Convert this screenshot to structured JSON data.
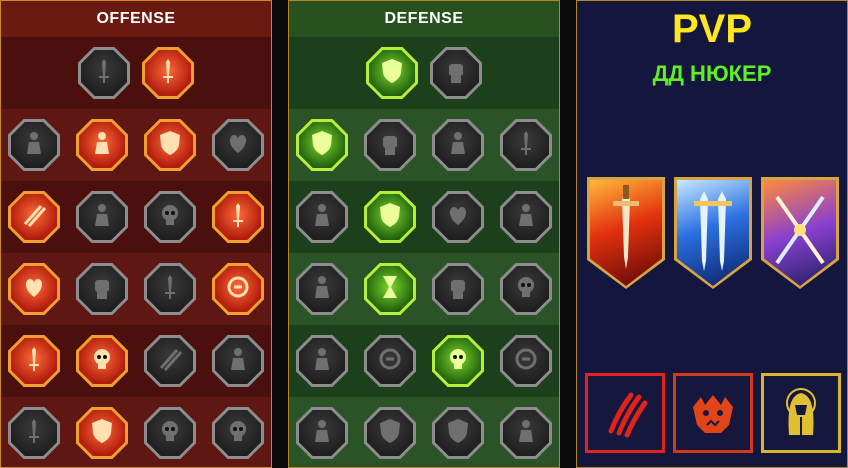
{
  "offense": {
    "title": "OFFENSE",
    "rows": [
      [
        {
          "icon": "crossed-swords-icon",
          "active": false
        },
        {
          "icon": "flaming-sword-icon",
          "active": true
        }
      ],
      [
        {
          "icon": "horned-warrior-icon",
          "active": false
        },
        {
          "icon": "triple-strike-icon",
          "active": true
        },
        {
          "icon": "shield-strike-icon",
          "active": true
        },
        {
          "icon": "heart-crest-icon",
          "active": false
        }
      ],
      [
        {
          "icon": "blade-flurry-icon",
          "active": true
        },
        {
          "icon": "fanged-maw-icon",
          "active": false
        },
        {
          "icon": "skull-bash-icon",
          "active": false
        },
        {
          "icon": "axe-swing-icon",
          "active": true
        }
      ],
      [
        {
          "icon": "bleeding-heart-icon",
          "active": true
        },
        {
          "icon": "iron-fist-icon",
          "active": false
        },
        {
          "icon": "war-axe-icon",
          "active": false
        },
        {
          "icon": "lightning-chain-icon",
          "active": true
        }
      ],
      [
        {
          "icon": "sword-burst-icon",
          "active": true
        },
        {
          "icon": "skull-trio-icon",
          "active": true
        },
        {
          "icon": "arcane-slash-icon",
          "active": false
        },
        {
          "icon": "fury-warrior-icon",
          "active": false
        }
      ],
      [
        {
          "icon": "sparkling-blade-icon",
          "active": false
        },
        {
          "icon": "flaming-helm-icon",
          "active": true
        },
        {
          "icon": "demon-icon",
          "active": false
        },
        {
          "icon": "skull-totem-icon",
          "active": false
        }
      ]
    ]
  },
  "defense": {
    "title": "DEFENSE",
    "rows": [
      [
        {
          "icon": "stacked-shields-icon",
          "active": true
        },
        {
          "icon": "raised-fist-icon",
          "active": false
        }
      ],
      [
        {
          "icon": "chevron-shield-icon",
          "active": true
        },
        {
          "icon": "stone-hand-icon",
          "active": false
        },
        {
          "icon": "armored-torso-icon",
          "active": false
        },
        {
          "icon": "broken-blade-icon",
          "active": false
        }
      ],
      [
        {
          "icon": "leaping-fighter-icon",
          "active": false
        },
        {
          "icon": "knight-shield-icon",
          "active": true
        },
        {
          "icon": "heart-icon",
          "active": false
        },
        {
          "icon": "hooded-head-icon",
          "active": false
        }
      ],
      [
        {
          "icon": "warrior-pair-icon",
          "active": false
        },
        {
          "icon": "hourglass-icon",
          "active": true
        },
        {
          "icon": "open-palm-icon",
          "active": false
        },
        {
          "icon": "bull-skull-icon",
          "active": false
        }
      ],
      [
        {
          "icon": "speed-runner-icon",
          "active": false
        },
        {
          "icon": "water-drops-icon",
          "active": false
        },
        {
          "icon": "radiant-skull-icon",
          "active": true
        },
        {
          "icon": "swirl-arrow-icon",
          "active": false
        }
      ],
      [
        {
          "icon": "stone-golem-icon",
          "active": false
        },
        {
          "icon": "crested-shield-icon",
          "active": false
        },
        {
          "icon": "helmed-face-icon",
          "active": false
        },
        {
          "icon": "strongman-icon",
          "active": false
        }
      ]
    ]
  },
  "pvp": {
    "title": "PVP",
    "subtitle": "ДД НЮКЕР",
    "banners": [
      {
        "icon": "red-sword-banner-icon"
      },
      {
        "icon": "blue-twin-swords-banner-icon"
      },
      {
        "icon": "crossed-swords-banner-icon"
      }
    ],
    "boxes": [
      {
        "icon": "claw-marks-icon"
      },
      {
        "icon": "beast-head-icon"
      },
      {
        "icon": "robed-sage-icon"
      }
    ]
  },
  "colors": {
    "offense_bg": "#5a1410",
    "defense_bg": "#1f4421",
    "pvp_bg": "#14163e",
    "gold": "#d6a542",
    "pvp_title": "#ffe61e",
    "pvp_subtitle": "#5ef025"
  }
}
